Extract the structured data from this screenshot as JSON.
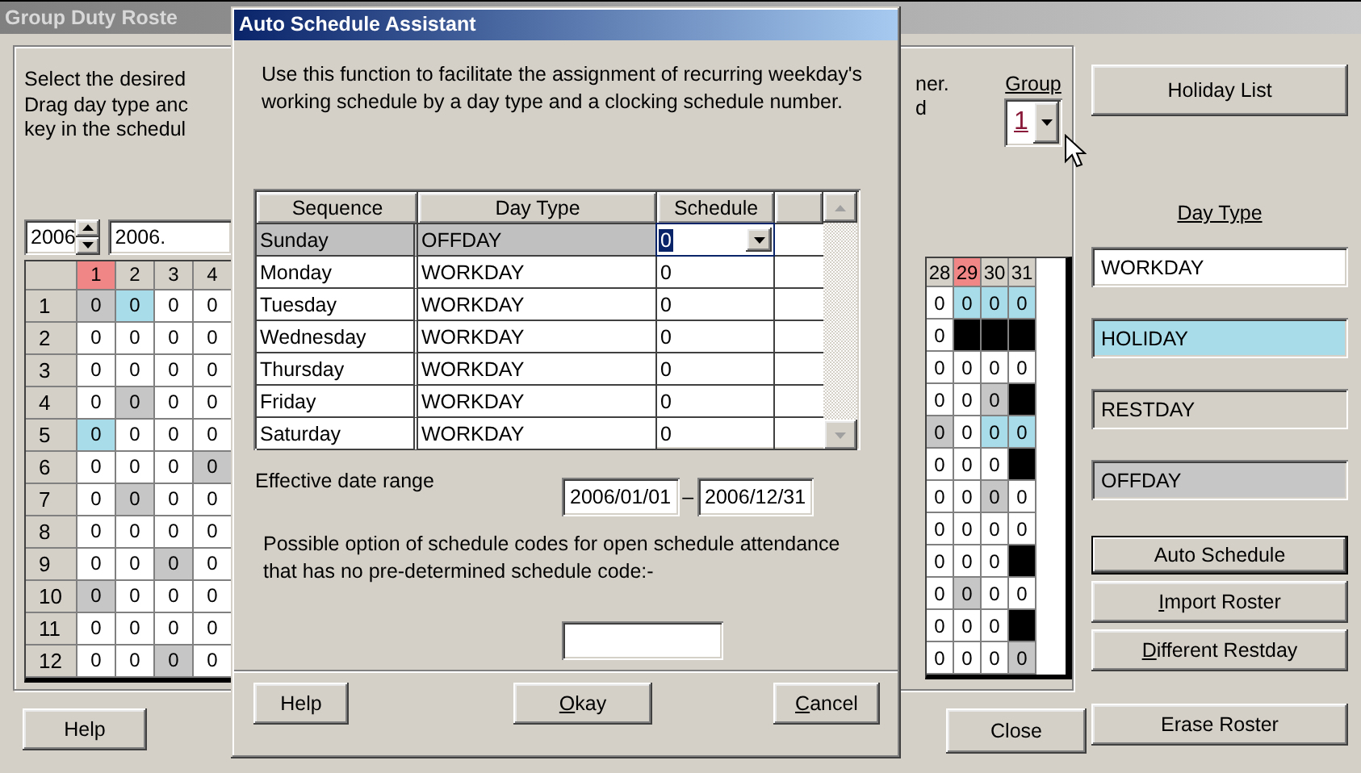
{
  "main_window": {
    "title": "Group Duty Roste",
    "instructions": [
      "Select the desired",
      "Drag day type anc",
      "key in the schedul"
    ],
    "instructions_right": [
      "ner.",
      "d"
    ],
    "year": "2006",
    "date_field": "2006.",
    "group": {
      "label": "Group",
      "value": "1"
    },
    "grid_left": {
      "columns": [
        {
          "label": "1",
          "holiday": true
        },
        {
          "label": "2",
          "holiday": false
        },
        {
          "label": "3",
          "holiday": false
        },
        {
          "label": "4",
          "holiday": false
        }
      ],
      "rows": [
        {
          "label": "1",
          "cells": [
            {
              "value": "0",
              "kind": "offday"
            },
            {
              "value": "0",
              "kind": "holiday"
            },
            {
              "value": "0",
              "kind": "workday"
            },
            {
              "value": "0",
              "kind": "workday"
            }
          ]
        },
        {
          "label": "2",
          "cells": [
            {
              "value": "0",
              "kind": "workday"
            },
            {
              "value": "0",
              "kind": "workday"
            },
            {
              "value": "0",
              "kind": "workday"
            },
            {
              "value": "0",
              "kind": "workday"
            }
          ]
        },
        {
          "label": "3",
          "cells": [
            {
              "value": "0",
              "kind": "workday"
            },
            {
              "value": "0",
              "kind": "workday"
            },
            {
              "value": "0",
              "kind": "workday"
            },
            {
              "value": "0",
              "kind": "workday"
            }
          ]
        },
        {
          "label": "4",
          "cells": [
            {
              "value": "0",
              "kind": "workday"
            },
            {
              "value": "0",
              "kind": "offday"
            },
            {
              "value": "0",
              "kind": "workday"
            },
            {
              "value": "0",
              "kind": "workday"
            }
          ]
        },
        {
          "label": "5",
          "cells": [
            {
              "value": "0",
              "kind": "holiday"
            },
            {
              "value": "0",
              "kind": "workday"
            },
            {
              "value": "0",
              "kind": "workday"
            },
            {
              "value": "0",
              "kind": "workday"
            }
          ]
        },
        {
          "label": "6",
          "cells": [
            {
              "value": "0",
              "kind": "workday"
            },
            {
              "value": "0",
              "kind": "workday"
            },
            {
              "value": "0",
              "kind": "workday"
            },
            {
              "value": "0",
              "kind": "offday"
            }
          ]
        },
        {
          "label": "7",
          "cells": [
            {
              "value": "0",
              "kind": "workday"
            },
            {
              "value": "0",
              "kind": "offday"
            },
            {
              "value": "0",
              "kind": "workday"
            },
            {
              "value": "0",
              "kind": "workday"
            }
          ]
        },
        {
          "label": "8",
          "cells": [
            {
              "value": "0",
              "kind": "workday"
            },
            {
              "value": "0",
              "kind": "workday"
            },
            {
              "value": "0",
              "kind": "workday"
            },
            {
              "value": "0",
              "kind": "workday"
            }
          ]
        },
        {
          "label": "9",
          "cells": [
            {
              "value": "0",
              "kind": "workday"
            },
            {
              "value": "0",
              "kind": "workday"
            },
            {
              "value": "0",
              "kind": "offday"
            },
            {
              "value": "0",
              "kind": "workday"
            }
          ]
        },
        {
          "label": "10",
          "cells": [
            {
              "value": "0",
              "kind": "offday"
            },
            {
              "value": "0",
              "kind": "workday"
            },
            {
              "value": "0",
              "kind": "workday"
            },
            {
              "value": "0",
              "kind": "workday"
            }
          ]
        },
        {
          "label": "11",
          "cells": [
            {
              "value": "0",
              "kind": "workday"
            },
            {
              "value": "0",
              "kind": "workday"
            },
            {
              "value": "0",
              "kind": "workday"
            },
            {
              "value": "0",
              "kind": "workday"
            }
          ]
        },
        {
          "label": "12",
          "cells": [
            {
              "value": "0",
              "kind": "workday"
            },
            {
              "value": "0",
              "kind": "workday"
            },
            {
              "value": "0",
              "kind": "offday"
            },
            {
              "value": "0",
              "kind": "workday"
            }
          ]
        }
      ]
    },
    "grid_right": {
      "columns": [
        {
          "label": "28",
          "holiday": false
        },
        {
          "label": "29",
          "holiday": true
        },
        {
          "label": "30",
          "holiday": false
        },
        {
          "label": "31",
          "holiday": false
        }
      ],
      "rows": [
        {
          "cells": [
            {
              "value": "0",
              "kind": "workday"
            },
            {
              "value": "0",
              "kind": "holiday"
            },
            {
              "value": "0",
              "kind": "holiday"
            },
            {
              "value": "0",
              "kind": "holiday"
            }
          ]
        },
        {
          "cells": [
            {
              "value": "0",
              "kind": "workday"
            },
            {
              "kind": "none"
            },
            {
              "kind": "none"
            },
            {
              "kind": "none"
            }
          ]
        },
        {
          "cells": [
            {
              "value": "0",
              "kind": "workday"
            },
            {
              "value": "0",
              "kind": "workday"
            },
            {
              "value": "0",
              "kind": "workday"
            },
            {
              "value": "0",
              "kind": "workday"
            }
          ]
        },
        {
          "cells": [
            {
              "value": "0",
              "kind": "workday"
            },
            {
              "value": "0",
              "kind": "workday"
            },
            {
              "value": "0",
              "kind": "offday"
            },
            {
              "kind": "none"
            }
          ]
        },
        {
          "cells": [
            {
              "value": "0",
              "kind": "offday"
            },
            {
              "value": "0",
              "kind": "workday"
            },
            {
              "value": "0",
              "kind": "holiday"
            },
            {
              "value": "0",
              "kind": "holiday"
            }
          ]
        },
        {
          "cells": [
            {
              "value": "0",
              "kind": "workday"
            },
            {
              "value": "0",
              "kind": "workday"
            },
            {
              "value": "0",
              "kind": "workday"
            },
            {
              "kind": "none"
            }
          ]
        },
        {
          "cells": [
            {
              "value": "0",
              "kind": "workday"
            },
            {
              "value": "0",
              "kind": "workday"
            },
            {
              "value": "0",
              "kind": "offday"
            },
            {
              "value": "0",
              "kind": "workday"
            }
          ]
        },
        {
          "cells": [
            {
              "value": "0",
              "kind": "workday"
            },
            {
              "value": "0",
              "kind": "workday"
            },
            {
              "value": "0",
              "kind": "workday"
            },
            {
              "value": "0",
              "kind": "workday"
            }
          ]
        },
        {
          "cells": [
            {
              "value": "0",
              "kind": "workday"
            },
            {
              "value": "0",
              "kind": "workday"
            },
            {
              "value": "0",
              "kind": "workday"
            },
            {
              "kind": "none"
            }
          ]
        },
        {
          "cells": [
            {
              "value": "0",
              "kind": "workday"
            },
            {
              "value": "0",
              "kind": "offday"
            },
            {
              "value": "0",
              "kind": "workday"
            },
            {
              "value": "0",
              "kind": "workday"
            }
          ]
        },
        {
          "cells": [
            {
              "value": "0",
              "kind": "workday"
            },
            {
              "value": "0",
              "kind": "workday"
            },
            {
              "value": "0",
              "kind": "workday"
            },
            {
              "kind": "none"
            }
          ]
        },
        {
          "cells": [
            {
              "value": "0",
              "kind": "workday"
            },
            {
              "value": "0",
              "kind": "workday"
            },
            {
              "value": "0",
              "kind": "workday"
            },
            {
              "value": "0",
              "kind": "offday"
            }
          ]
        }
      ]
    },
    "side_panel": {
      "holiday_list_button": "Holiday List",
      "day_type_label": "Day Type",
      "day_types": [
        {
          "label": "WORKDAY",
          "kind": "workday"
        },
        {
          "label": "HOLIDAY",
          "kind": "holiday"
        },
        {
          "label": "RESTDAY",
          "kind": "restday"
        },
        {
          "label": "OFFDAY",
          "kind": "offday"
        }
      ],
      "buttons": [
        {
          "label": "Auto Schedule",
          "default": true,
          "mnemonic": false
        },
        {
          "label": "Import Roster",
          "default": false,
          "mnemonic": true
        },
        {
          "label": "Different Restday",
          "default": false,
          "mnemonic": true
        }
      ],
      "erase_button": "Erase Roster"
    },
    "help_button": "Help",
    "close_button": "Close"
  },
  "dialog": {
    "title": "Auto Schedule Assistant",
    "description": "Use this function to facilitate the assignment of recurring weekday's working schedule by a day type and a clocking schedule number.",
    "table": {
      "columns": [
        "Sequence",
        "Day Type",
        "Schedule"
      ],
      "rows": [
        {
          "sequence": "Sunday",
          "day_type": "OFFDAY",
          "schedule": "0",
          "selected": true
        },
        {
          "sequence": "Monday",
          "day_type": "WORKDAY",
          "schedule": "0",
          "selected": false
        },
        {
          "sequence": "Tuesday",
          "day_type": "WORKDAY",
          "schedule": "0",
          "selected": false
        },
        {
          "sequence": "Wednesday",
          "day_type": "WORKDAY",
          "schedule": "0",
          "selected": false
        },
        {
          "sequence": "Thursday",
          "day_type": "WORKDAY",
          "schedule": "0",
          "selected": false
        },
        {
          "sequence": "Friday",
          "day_type": "WORKDAY",
          "schedule": "0",
          "selected": false
        },
        {
          "sequence": "Saturday",
          "day_type": "WORKDAY",
          "schedule": "0",
          "selected": false
        }
      ]
    },
    "date_range_label": "Effective date range",
    "date_from": "2006/01/01",
    "date_separator": "–",
    "date_to": "2006/12/31",
    "option_note": "Possible option of schedule codes for open schedule attendance that has no pre-determined schedule code:-",
    "buttons": [
      {
        "label": "Help",
        "mnemonic": false
      },
      {
        "label": "Okay",
        "mnemonic": true
      },
      {
        "label": "Cancel",
        "mnemonic": true
      }
    ]
  }
}
